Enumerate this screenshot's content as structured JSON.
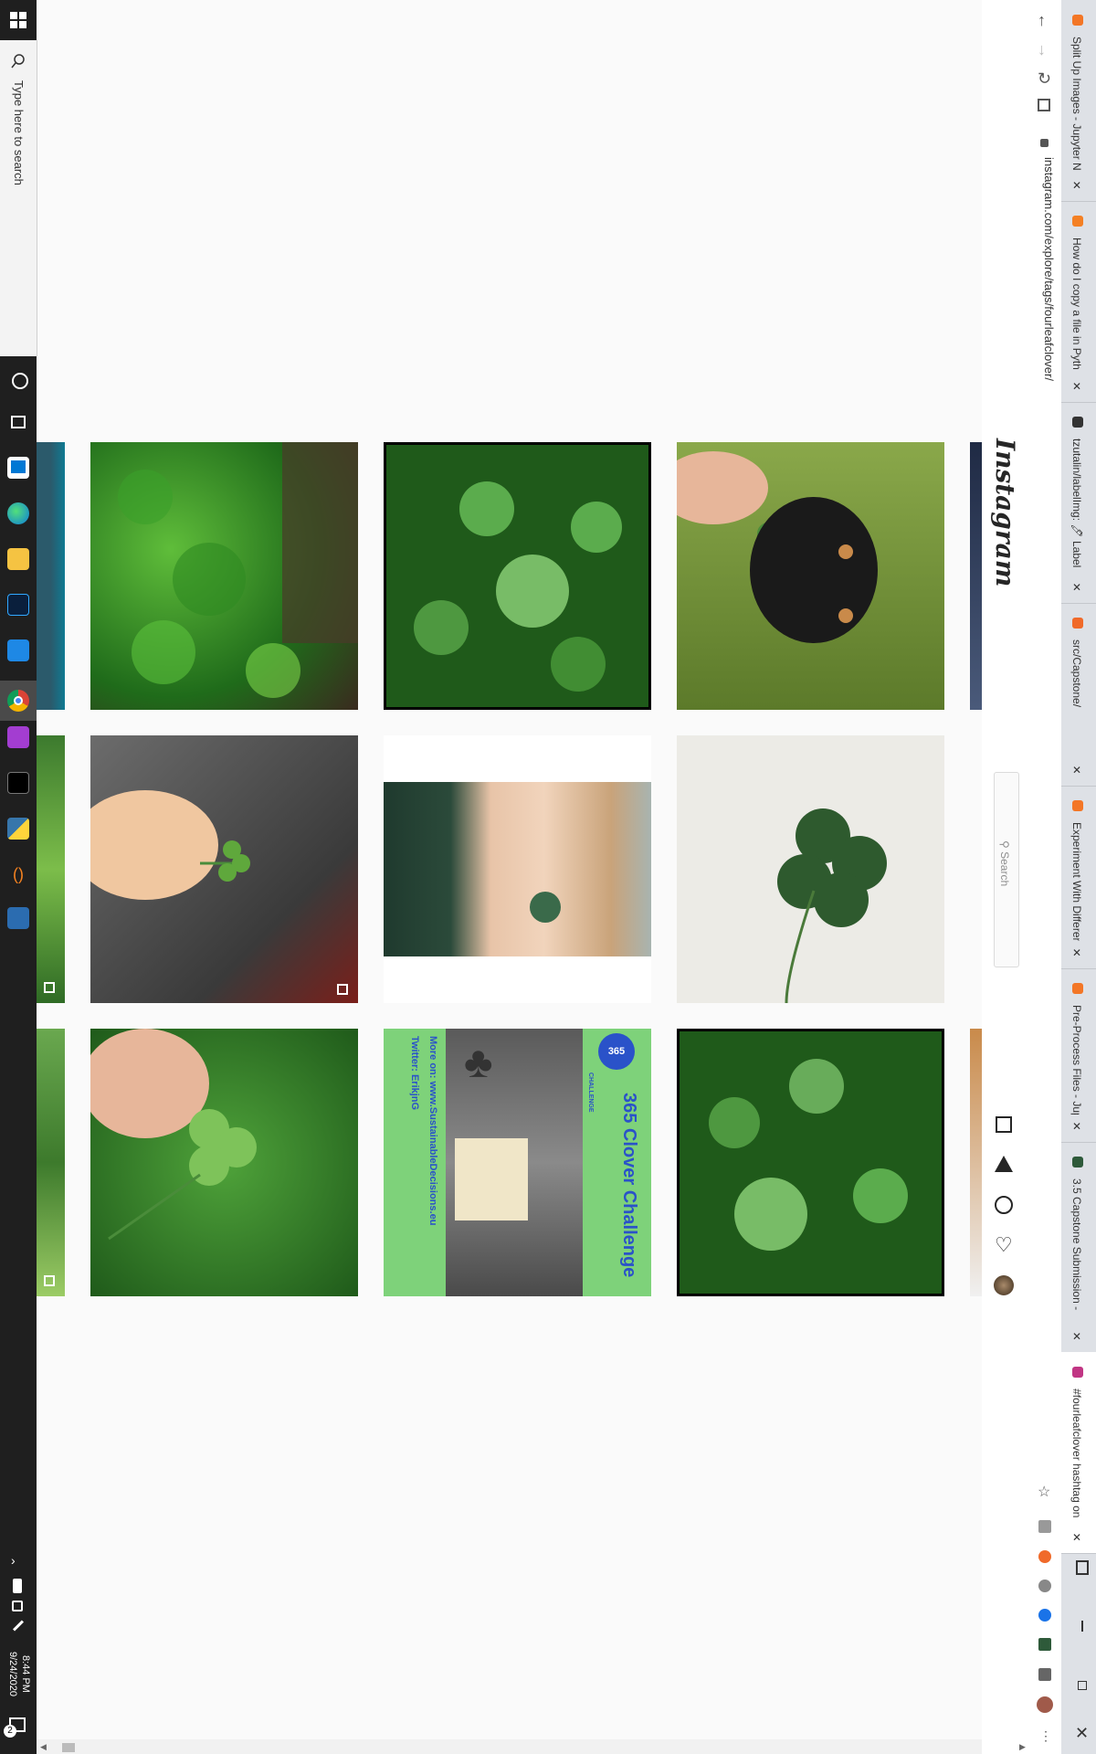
{
  "taskbar": {
    "search_placeholder": "Type here to search",
    "time": "8:44 PM",
    "date": "9/24/2020",
    "notification_count": "2",
    "apps": [
      "task-view",
      "store",
      "edge",
      "file-explorer",
      "photoshop",
      "azure-data-studio",
      "chrome",
      "onenote",
      "terminal",
      "python",
      "vs-brackets",
      "calculator"
    ]
  },
  "browser": {
    "url": "instagram.com/explore/tags/fourleafclover/",
    "tabs": [
      {
        "title": "Split Up Images - Jupyter N"
      },
      {
        "title": "How do I copy a file in Pyth"
      },
      {
        "title": "tzutalin/labelImg: 🖊 Label"
      },
      {
        "title": "src/Capstone/"
      },
      {
        "title": "Experiment With Different"
      },
      {
        "title": "Pre-Process Files - Jupyter"
      },
      {
        "title": "3.5 Capstone Submission -"
      },
      {
        "title": "#fourleafclover hashtag on"
      }
    ],
    "window_controls": [
      "split-view",
      "minimize",
      "restore",
      "close"
    ]
  },
  "instagram": {
    "logo": "Instagram",
    "search_placeholder": "Search"
  },
  "posts": {
    "tile6_text": {
      "title": "365 Clover Challenge",
      "badge": "365",
      "badge_sub": "CHALLENGE",
      "line1": "More on: www.SustainableDecisions.eu",
      "line2": "Twitter: ErikjnG"
    }
  },
  "colors": {
    "taskbar_bg": "#1f1f1f",
    "clover_green": "#4a8c3a",
    "challenge_bg": "#7ed27a",
    "challenge_text": "#2a52c9"
  }
}
